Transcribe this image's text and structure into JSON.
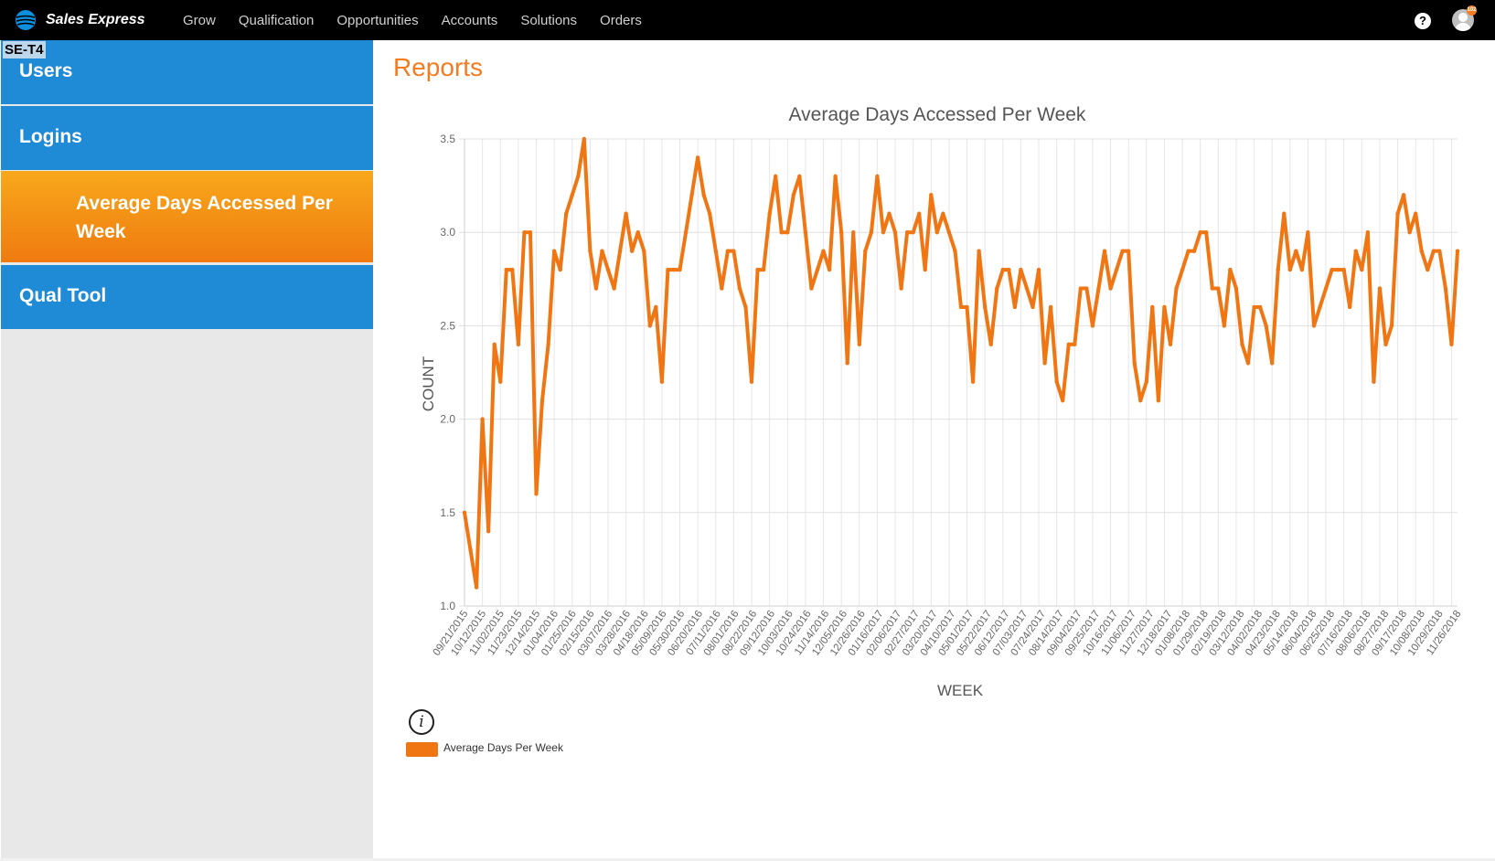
{
  "header": {
    "brand": "Sales Express",
    "nav": [
      "Grow",
      "Qualification",
      "Opportunities",
      "Accounts",
      "Solutions",
      "Orders"
    ],
    "help_icon": "question-icon",
    "avatar_badge": "102"
  },
  "env_tag": "SE-T4",
  "sidebar": {
    "items": [
      {
        "label": "Users"
      },
      {
        "label": "Logins"
      },
      {
        "label": "Average Days Accessed Per Week"
      },
      {
        "label": "Qual Tool"
      }
    ]
  },
  "page": {
    "title": "Reports"
  },
  "legend": {
    "label": "Average Days Per Week",
    "icon": "info-icon"
  },
  "chart_data": {
    "type": "line",
    "title": "Average Days Accessed Per Week",
    "xlabel": "WEEK",
    "ylabel": "COUNT",
    "ylim": [
      1.0,
      3.5
    ],
    "yticks": [
      "1.0",
      "1.5",
      "2.0",
      "2.5",
      "3.0",
      "3.5"
    ],
    "color": "#f07613",
    "grid": true,
    "x_tick_labels": [
      "09/21/2015",
      "10/12/2015",
      "11/02/2015",
      "11/23/2015",
      "12/14/2015",
      "01/04/2016",
      "01/25/2016",
      "02/15/2016",
      "03/07/2016",
      "03/28/2016",
      "04/18/2016",
      "05/09/2016",
      "05/30/2016",
      "06/20/2016",
      "07/11/2016",
      "08/01/2016",
      "08/22/2016",
      "09/12/2016",
      "10/03/2016",
      "10/24/2016",
      "11/14/2016",
      "12/05/2016",
      "12/26/2016",
      "01/16/2017",
      "02/06/2017",
      "02/27/2017",
      "03/20/2017",
      "04/10/2017",
      "05/01/2017",
      "05/22/2017",
      "06/12/2017",
      "07/03/2017",
      "07/24/2017",
      "08/14/2017",
      "09/04/2017",
      "09/25/2017",
      "10/16/2017",
      "11/06/2017",
      "11/27/2017",
      "12/18/2017",
      "01/08/2018",
      "01/29/2018",
      "02/19/2018",
      "03/12/2018",
      "04/02/2018",
      "04/23/2018",
      "05/14/2018",
      "06/04/2018",
      "06/25/2018",
      "07/16/2018",
      "08/06/2018",
      "08/27/2018",
      "09/17/2018",
      "10/08/2018",
      "10/29/2018",
      "11/26/2018"
    ],
    "series": [
      {
        "name": "Average Days Per Week",
        "values": [
          1.5,
          1.3,
          1.1,
          2.0,
          1.4,
          2.4,
          2.2,
          2.8,
          2.8,
          2.4,
          3.0,
          3.0,
          1.6,
          2.1,
          2.4,
          2.9,
          2.8,
          3.1,
          3.2,
          3.3,
          3.5,
          2.9,
          2.7,
          2.9,
          2.8,
          2.7,
          2.9,
          3.1,
          2.9,
          3.0,
          2.9,
          2.5,
          2.6,
          2.2,
          2.8,
          2.8,
          2.8,
          3.0,
          3.2,
          3.4,
          3.2,
          3.1,
          2.9,
          2.7,
          2.9,
          2.9,
          2.7,
          2.6,
          2.2,
          2.8,
          2.8,
          3.1,
          3.3,
          3.0,
          3.0,
          3.2,
          3.3,
          3.0,
          2.7,
          2.8,
          2.9,
          2.8,
          3.3,
          3.0,
          2.3,
          3.0,
          2.4,
          2.9,
          3.0,
          3.3,
          3.0,
          3.1,
          3.0,
          2.7,
          3.0,
          3.0,
          3.1,
          2.8,
          3.2,
          3.0,
          3.1,
          3.0,
          2.9,
          2.6,
          2.6,
          2.2,
          2.9,
          2.6,
          2.4,
          2.7,
          2.8,
          2.8,
          2.6,
          2.8,
          2.7,
          2.6,
          2.8,
          2.3,
          2.6,
          2.2,
          2.1,
          2.4,
          2.4,
          2.7,
          2.7,
          2.5,
          2.7,
          2.9,
          2.7,
          2.8,
          2.9,
          2.9,
          2.3,
          2.1,
          2.2,
          2.6,
          2.1,
          2.6,
          2.4,
          2.7,
          2.8,
          2.9,
          2.9,
          3.0,
          3.0,
          2.7,
          2.7,
          2.5,
          2.8,
          2.7,
          2.4,
          2.3,
          2.6,
          2.6,
          2.5,
          2.3,
          2.8,
          3.1,
          2.8,
          2.9,
          2.8,
          3.0,
          2.5,
          2.6,
          2.7,
          2.8,
          2.8,
          2.8,
          2.6,
          2.9,
          2.8,
          3.0,
          2.2,
          2.7,
          2.4,
          2.5,
          3.1,
          3.2,
          3.0,
          3.1,
          2.9,
          2.8,
          2.9,
          2.9,
          2.7,
          2.4,
          2.9
        ]
      }
    ]
  }
}
